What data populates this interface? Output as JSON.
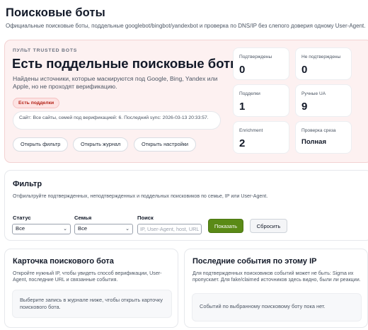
{
  "page": {
    "title": "Поисковые боты",
    "subtitle": "Официальные поисковые боты, поддельные googlebot/bingbot/yandexbot и проверка по DNS/IP без слепого доверия одному User-Agent."
  },
  "hero": {
    "kicker": "ПУЛЬТ TRUSTED BOTS",
    "title": "Есть поддельные поисковые боты",
    "description": "Найдены источники, которые маскируются под Google, Bing, Yandex или Apple, но не проходят верификацию.",
    "badge": "Есть подделки",
    "sync": "Сайт: Все сайты, семей под верификацией: 6. Последний sync: 2026-03-13 20:33:57.",
    "buttons": {
      "filter": "Открыть фильтр",
      "journal": "Открыть журнал",
      "settings": "Открыть настройки"
    },
    "stats": [
      {
        "label": "Подтверждены",
        "value": "0"
      },
      {
        "label": "Не подтверждены",
        "value": "0"
      },
      {
        "label": "Подделки",
        "value": "1"
      },
      {
        "label": "Ручные UA",
        "value": "9"
      },
      {
        "label": "Enrichment",
        "value": "2"
      },
      {
        "label": "Проверка среза",
        "value": "Полная"
      }
    ]
  },
  "filter": {
    "title": "Фильтр",
    "description": "Отфильтруйте подтвержденных, неподтвержденных и поддельных поисковиков по семье, IP или User-Agent.",
    "status_label": "Статус",
    "status_value": "Все",
    "family_label": "Семья",
    "family_value": "Все",
    "search_label": "Поиск",
    "search_placeholder": "IP, User-Agent, host, URL",
    "show_button": "Показать",
    "reset_button": "Сбросить"
  },
  "bot_card": {
    "title": "Карточка поискового бота",
    "description": "Откройте нужный IP, чтобы увидеть способ верификации, User-Agent, последние URL и связанные события.",
    "empty": "Выберите запись в журнале ниже, чтобы открыть карточку поискового бота."
  },
  "events": {
    "title": "Последние события по этому IP",
    "description": "Для подтвержденных поисковиков событий может не быть: Sigma их пропускает. Для fake/claimed источников здесь видно, были ли реакции.",
    "empty": "Событий по выбранному поисковому боту пока нет."
  }
}
